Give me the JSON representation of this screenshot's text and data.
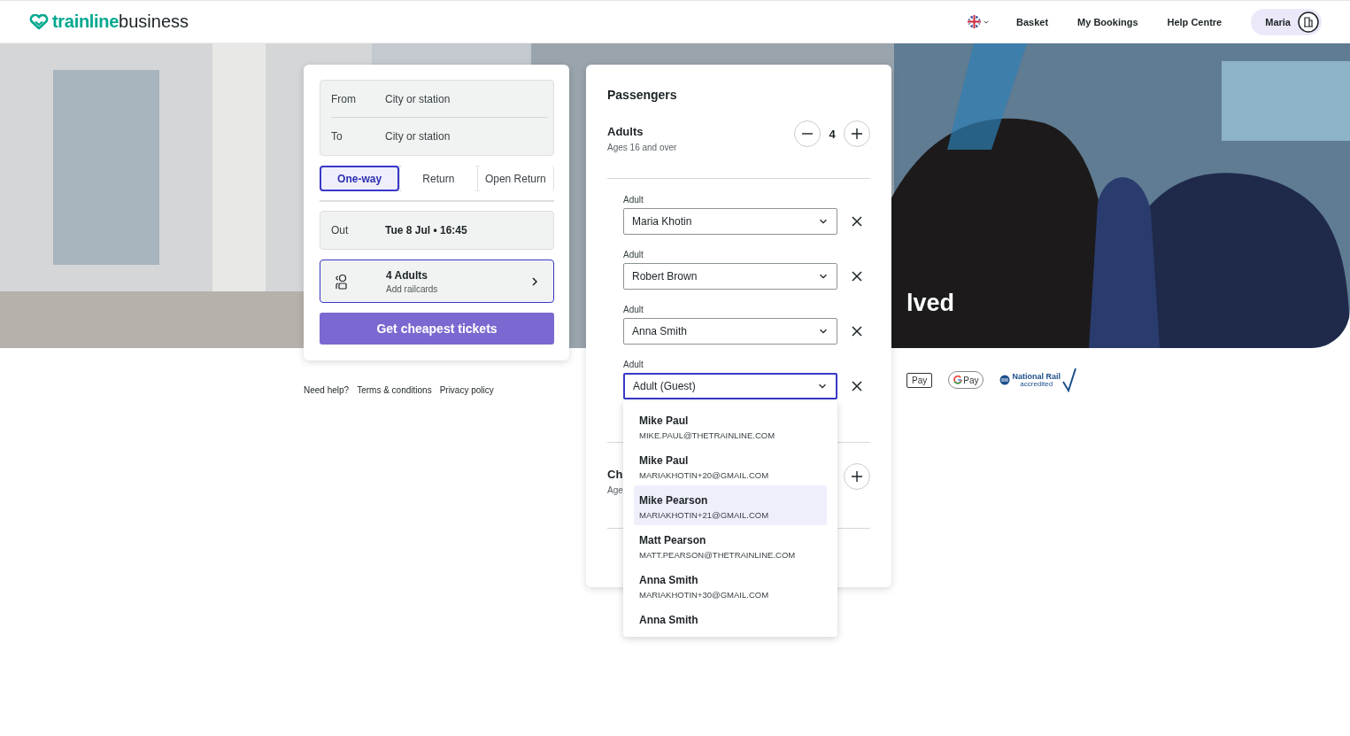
{
  "header": {
    "logo": {
      "brand": "trainline",
      "suffix": "business"
    },
    "nav": [
      "Basket",
      "My Bookings",
      "Help Centre"
    ],
    "user": {
      "name": "Maria"
    }
  },
  "hero": {
    "headline": "lved"
  },
  "search": {
    "from": {
      "label": "From",
      "placeholder": "City or station"
    },
    "to": {
      "label": "To",
      "placeholder": "City or station"
    },
    "journey_types": [
      {
        "label": "One-way",
        "selected": true
      },
      {
        "label": "Return",
        "selected": false
      },
      {
        "label": "Open Return",
        "selected": false
      }
    ],
    "out": {
      "label": "Out",
      "value": "Tue 8 Jul • 16:45"
    },
    "passengers_summary": {
      "title": "4 Adults",
      "subtitle": "Add railcards"
    },
    "search_button": "Get cheapest tickets"
  },
  "footer_links": [
    "Need help?",
    "Terms & conditions",
    "Privacy policy"
  ],
  "passengers_panel": {
    "title": "Passengers",
    "adults": {
      "label": "Adults",
      "subtitle": "Ages 16 and over",
      "count": "4"
    },
    "adult_slots": [
      {
        "label": "Adult",
        "value": "Maria Khotin",
        "focused": false
      },
      {
        "label": "Adult",
        "value": "Robert Brown",
        "focused": false
      },
      {
        "label": "Adult",
        "value": "Anna Smith",
        "focused": false
      },
      {
        "label": "Adult",
        "value": "Adult (Guest)",
        "focused": true
      }
    ],
    "children": {
      "label": "Ch",
      "subtitle": "Age"
    },
    "dropdown": {
      "options": [
        {
          "name": "Mike Paul",
          "email": "MIKE.PAUL@THETRAINLINE.COM",
          "selected": false
        },
        {
          "name": "Mike Paul",
          "email": "MARIAKHOTIN+20@GMAIL.COM",
          "selected": false
        },
        {
          "name": "Mike Pearson",
          "email": "MARIAKHOTIN+21@GMAIL.COM",
          "selected": true
        },
        {
          "name": "Matt Pearson",
          "email": "MATT.PEARSON@THETRAINLINE.COM",
          "selected": false
        },
        {
          "name": "Anna Smith",
          "email": "MARIAKHOTIN+30@GMAIL.COM",
          "selected": false
        },
        {
          "name": "Anna Smith",
          "selected": false
        }
      ]
    }
  },
  "payment_badges": [
    {
      "kind": "apple",
      "text": "Pay"
    },
    {
      "kind": "google",
      "text": "Pay"
    }
  ],
  "accreditation": {
    "title": "National Rail",
    "subtitle": "accredited"
  }
}
